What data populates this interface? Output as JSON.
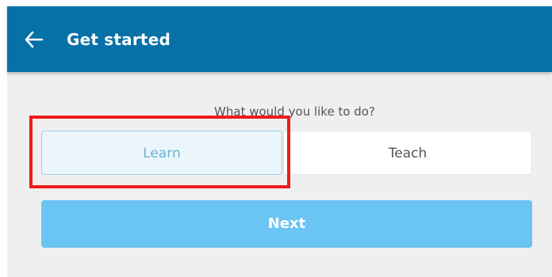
{
  "header": {
    "title": "Get started",
    "back_icon": "arrow-left-icon"
  },
  "prompt": "What would you like to do?",
  "options": {
    "learn_label": "Learn",
    "teach_label": "Teach",
    "selected": "Learn"
  },
  "next_label": "Next",
  "colors": {
    "app_bar": "#0671a7",
    "background": "#efefef",
    "selected_bg": "#eaf6fc",
    "selected_text": "#6fb1cf",
    "next_button": "#6ac4f4",
    "highlight": "#ef1b1b"
  }
}
